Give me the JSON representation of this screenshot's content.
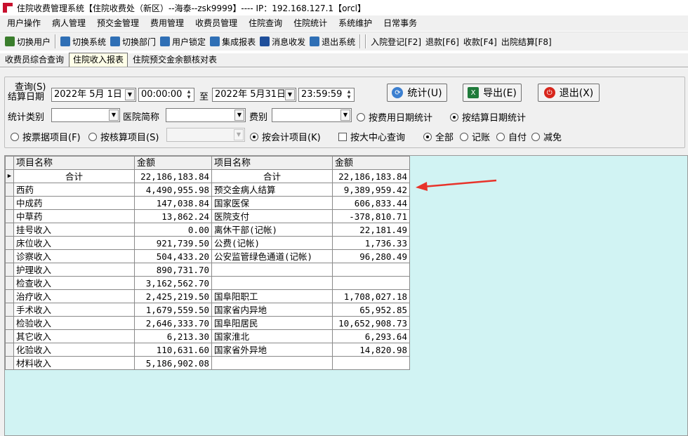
{
  "window": {
    "title": "住院收费管理系统【住院收费处（新区）--海泰--zsk9999】---- IP：192.168.127.1【orcl】"
  },
  "menu": [
    "用户操作",
    "病人管理",
    "预交金管理",
    "费用管理",
    "收费员管理",
    "住院查询",
    "住院统计",
    "系统维护",
    "日常事务"
  ],
  "toolbar": [
    {
      "label": "切换用户",
      "icon": "users-icon",
      "color": "#3a7d2c"
    },
    {
      "label": "切换系统",
      "icon": "switch-system-icon",
      "color": "#2f6fb5"
    },
    {
      "label": "切换部门",
      "icon": "switch-dept-icon",
      "color": "#2f6fb5"
    },
    {
      "label": "用户锁定",
      "icon": "user-lock-icon",
      "color": "#2f6fb5"
    },
    {
      "label": "集成报表",
      "icon": "report-icon",
      "color": "#2f6fb5"
    },
    {
      "label": "消息收发",
      "icon": "info-icon",
      "color": "#1f4f9a"
    },
    {
      "label": "退出系统",
      "icon": "exit-icon",
      "color": "#2f6fb5"
    },
    {
      "label": "入院登记[F2]"
    },
    {
      "label": "退款[F6]"
    },
    {
      "label": "收款[F4]"
    },
    {
      "label": "出院结算[F8]"
    }
  ],
  "tabs": [
    "收费员综合查询",
    "住院收入报表",
    "住院预交金余额核对表"
  ],
  "query": {
    "title": "查询(S)",
    "settle_date_label": "结算日期",
    "date_from": "2022年 5月 1日",
    "time_from": "00:00:00",
    "to_label": "至",
    "date_to": "2022年 5月31日",
    "time_to": "23:59:59",
    "category_label": "统计类别",
    "category_value": "",
    "hospital_label": "医院简称",
    "hospital_value": "",
    "fee_label": "费别",
    "fee_value": "",
    "settle_item_value": "",
    "btn_stat": "统计(U)",
    "btn_export": "导出(E)",
    "btn_exit": "退出(X)",
    "radio_fee_date": "按费用日期统计",
    "radio_settle_date": "按结算日期统计",
    "radio_bill_item": "按票据项目(F)",
    "radio_settle_item": "按核算项目(S)",
    "radio_account_item": "按会计项目(K)",
    "check_center": "按大中心查询",
    "radio_all": "全部",
    "radio_charge": "记账",
    "radio_self": "自付",
    "radio_reduce": "减免"
  },
  "table": {
    "headers": [
      "项目名称",
      "金额",
      "项目名称",
      "金额"
    ],
    "rows": [
      [
        "合计",
        "22,186,183.84",
        "合计",
        "22,186,183.84"
      ],
      [
        "西药",
        "4,490,955.98",
        "预交金病人结算",
        "9,389,959.42"
      ],
      [
        "中成药",
        "147,038.84",
        "国家医保",
        "606,833.44"
      ],
      [
        "中草药",
        "13,862.24",
        "医院支付",
        "-378,810.71"
      ],
      [
        "挂号收入",
        "0.00",
        "离休干部(记帐)",
        "22,181.49"
      ],
      [
        "床位收入",
        "921,739.50",
        "公费(记帐)",
        "1,736.33"
      ],
      [
        "诊察收入",
        "504,433.20",
        "公安监管绿色通道(记帐)",
        "96,280.49"
      ],
      [
        "护理收入",
        "890,731.70",
        "",
        ""
      ],
      [
        "检查收入",
        "3,162,562.70",
        "",
        ""
      ],
      [
        "治疗收入",
        "2,425,219.50",
        "国阜阳职工",
        "1,708,027.18"
      ],
      [
        "手术收入",
        "1,679,559.50",
        "国家省内异地",
        "65,952.85"
      ],
      [
        "检验收入",
        "2,646,333.70",
        "国阜阳居民",
        "10,652,908.73"
      ],
      [
        "其它收入",
        "6,213.30",
        "国家淮北",
        "6,293.64"
      ],
      [
        "化验收入",
        "110,631.60",
        "国家省外异地",
        "14,820.98"
      ],
      [
        "材料收入",
        "5,186,902.08",
        "",
        ""
      ]
    ]
  },
  "colors": {
    "grid_bg": "#d1f3f3",
    "annotation": "#e8332a"
  }
}
